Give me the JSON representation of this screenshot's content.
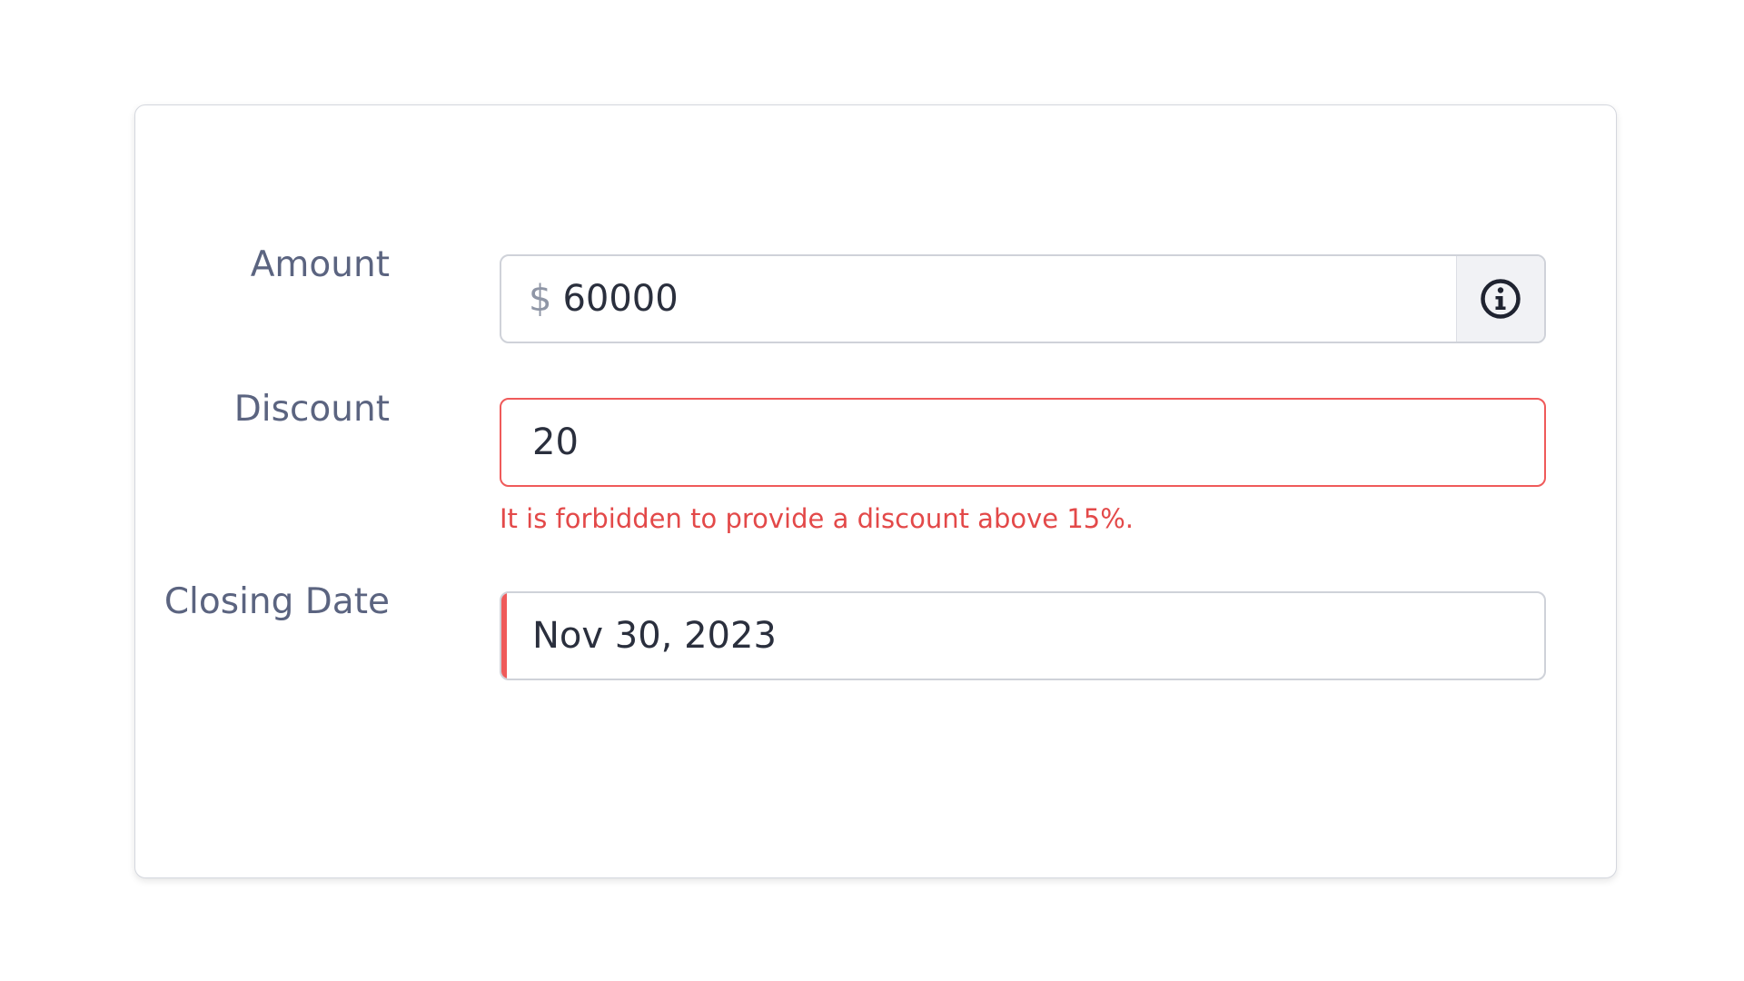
{
  "form": {
    "amount": {
      "label": "Amount",
      "currency_symbol": "$",
      "value": "60000",
      "info_icon": "info-icon"
    },
    "discount": {
      "label": "Discount",
      "value": "20",
      "error": "It is forbidden to provide a discount above 15%."
    },
    "closing_date": {
      "label": "Closing Date",
      "value": "Nov 30, 2023"
    }
  },
  "colors": {
    "label": "#5b6480",
    "error": "#ef5a5a",
    "border": "#cfd2d9",
    "addon_bg": "#f1f2f5"
  }
}
